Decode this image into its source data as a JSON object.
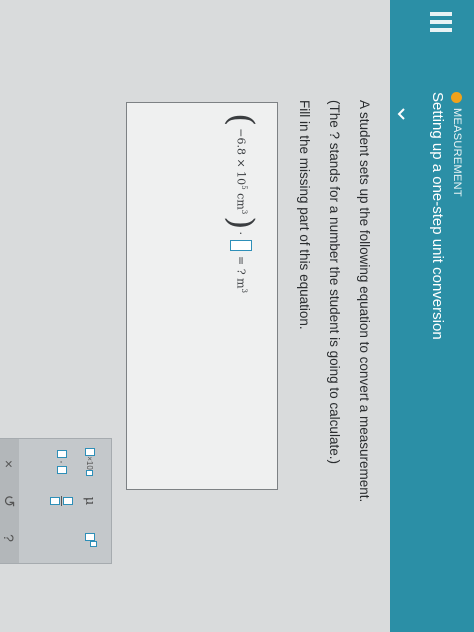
{
  "header": {
    "topic": "MEASUREMENT",
    "title": "Setting up a one-step unit conversion"
  },
  "problem": {
    "line1": "A student sets up the following equation to convert a measurement.",
    "line2": "(The ? stands for a number the student is going to calculate.)",
    "line3": "Fill in the missing part of this equation."
  },
  "equation": {
    "open_paren": "(",
    "coefficient": "−6.8 × 10",
    "exponent": "5",
    "unit": "cm",
    "unit_power": "3",
    "close_paren": ")",
    "dot": "·",
    "rhs": "= ? m",
    "rhs_power": "3"
  },
  "keypad": {
    "mu": "μ",
    "times": "×",
    "undo": "↺",
    "help": "?"
  },
  "colors": {
    "header": "#2b8fa6",
    "topic_dot": "#f0a21b",
    "input_border": "#2e8fb8"
  }
}
